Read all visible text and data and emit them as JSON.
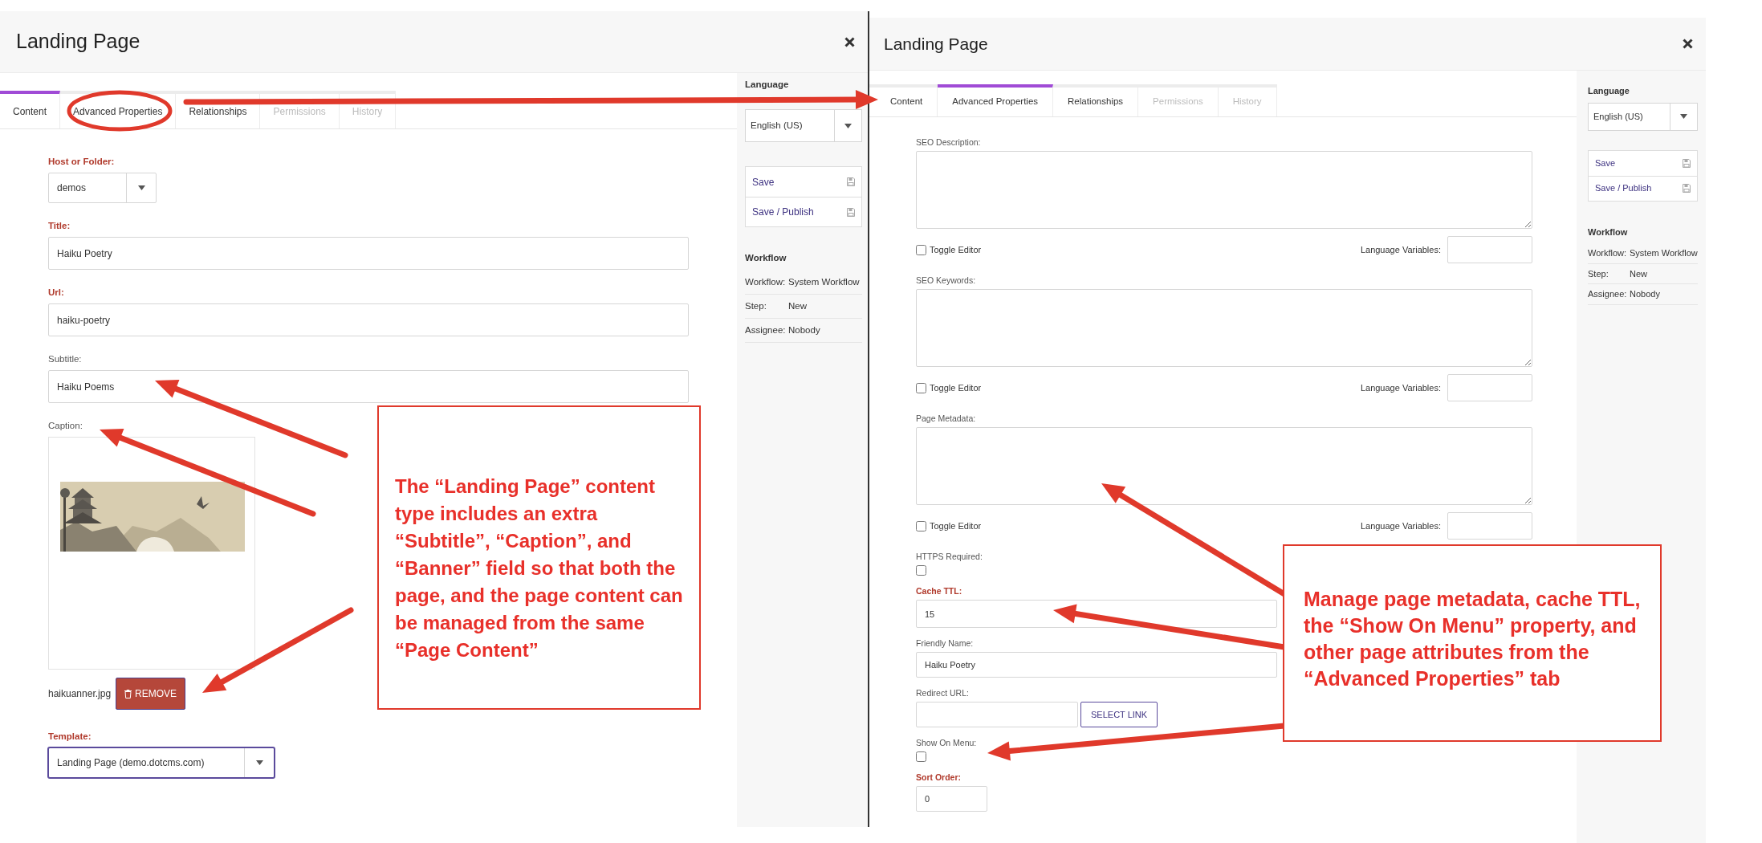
{
  "panels": [
    {
      "title": "Landing Page",
      "tabs": [
        {
          "label": "Content",
          "selected": true,
          "disabled": false
        },
        {
          "label": "Advanced Properties",
          "selected": false,
          "disabled": false
        },
        {
          "label": "Relationships",
          "selected": false,
          "disabled": false
        },
        {
          "label": "Permissions",
          "selected": false,
          "disabled": true
        },
        {
          "label": "History",
          "selected": false,
          "disabled": true
        }
      ],
      "fields": [
        {
          "kind": "select",
          "label": "Host or Folder:",
          "required": true,
          "focused": false,
          "value": "demos"
        },
        {
          "kind": "text",
          "label": "Title:",
          "required": true,
          "focused": false,
          "value": "Haiku Poetry"
        },
        {
          "kind": "text",
          "label": "Url:",
          "required": true,
          "focused": false,
          "value": "haiku-poetry"
        },
        {
          "kind": "text",
          "label": "Subtitle:",
          "required": false,
          "focused": false,
          "value": "Haiku Poems"
        },
        {
          "label": "Caption:",
          "required": false,
          "focused": false,
          "file": "haikuanner.jpg",
          "button": "REMOVE"
        },
        {
          "kind": "select",
          "label": "Template:",
          "required": true,
          "focused": true,
          "value": "Landing Page (demo.dotcms.com)"
        }
      ],
      "sidebar": {
        "language_label": "Language",
        "language": "English (US)",
        "actions": [
          {
            "label": "Save"
          },
          {
            "label": "Save / Publish"
          }
        ],
        "workflow_title": "Workflow",
        "workflow": [
          {
            "label": "Workflow:",
            "value": "System Workflow"
          },
          {
            "label": "Step:",
            "value": "New"
          },
          {
            "label": "Assignee:",
            "value": "Nobody"
          }
        ]
      }
    },
    {
      "title": "Landing Page",
      "tabs": [
        {
          "label": "Content",
          "selected": false,
          "disabled": false
        },
        {
          "label": "Advanced Properties",
          "selected": true,
          "disabled": false
        },
        {
          "label": "Relationships",
          "selected": false,
          "disabled": false
        },
        {
          "label": "Permissions",
          "selected": false,
          "disabled": true
        },
        {
          "label": "History",
          "selected": false,
          "disabled": true
        }
      ],
      "fields": [
        {
          "kind": "textarea",
          "label": "SEO Description:",
          "required": false,
          "toggle_label": "Toggle Editor",
          "checked": false,
          "variables_label": "Language Variables:"
        },
        {
          "kind": "textarea",
          "label": "SEO Keywords:",
          "required": false,
          "toggle_label": "Toggle Editor",
          "checked": false,
          "variables_label": "Language Variables:"
        },
        {
          "kind": "textarea",
          "label": "Page Metadata:",
          "required": false,
          "toggle_label": "Toggle Editor",
          "checked": false,
          "variables_label": "Language Variables:"
        },
        {
          "kind": "checkbox",
          "label": "HTTPS Required:",
          "required": false,
          "checked": false
        },
        {
          "kind": "text",
          "label": "Cache TTL:",
          "required": true,
          "value": "15"
        },
        {
          "kind": "text",
          "label": "Friendly Name:",
          "required": false,
          "value": "Haiku Poetry"
        },
        {
          "kind": "link",
          "label": "Redirect URL:",
          "required": false,
          "button": "SELECT LINK"
        },
        {
          "kind": "checkbox",
          "label": "Show On Menu:",
          "required": false,
          "checked": false
        },
        {
          "kind": "short_text",
          "label": "Sort Order:",
          "required": true,
          "value": "0"
        }
      ],
      "sidebar": {
        "language_label": "Language",
        "language": "English (US)",
        "actions": [
          {
            "label": "Save"
          },
          {
            "label": "Save / Publish"
          }
        ],
        "workflow_title": "Workflow",
        "workflow": [
          {
            "label": "Workflow:",
            "value": "System Workflow"
          },
          {
            "label": "Step:",
            "value": "New"
          },
          {
            "label": "Assignee:",
            "value": "Nobody"
          }
        ]
      }
    }
  ],
  "callouts": [
    {
      "text": "The “Landing Page” content type includes an extra “Subtitle”, “Caption”, and “Banner” field so that both the page, and the page content can be managed from the same “Page Content”"
    },
    {
      "text": "Manage page metadata, cache TTL, the “Show On Menu” property, and other page attributes from the “Advanced Properties” tab"
    }
  ]
}
